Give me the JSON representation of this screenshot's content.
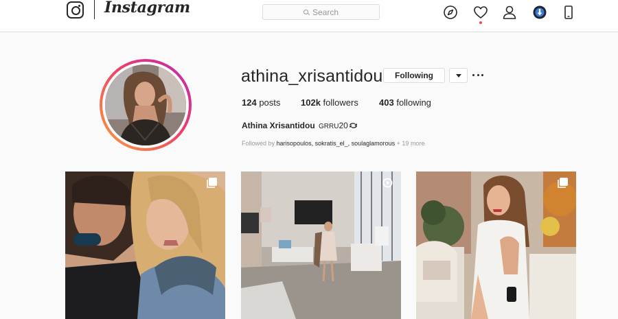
{
  "app": {
    "wordmark": "Instagram"
  },
  "nav": {
    "search_placeholder": "Search",
    "icons": [
      "compass-icon",
      "heart-icon",
      "person-icon",
      "download-icon",
      "phone-icon"
    ]
  },
  "profile": {
    "username": "athina_xrisantidou",
    "following_button": "Following",
    "stats": {
      "posts_count": "124",
      "posts_label": "posts",
      "followers_count": "102k",
      "followers_label": "followers",
      "following_count": "403",
      "following_label": "following"
    },
    "full_name": "Athina Xrisantidou",
    "bio_tag": "GRRU",
    "bio_num": "20",
    "followed_by": {
      "prefix": "Followed by",
      "users": "harisopoulos, sokratis_el_, soulaglamorous",
      "more": "+ 19 more"
    }
  },
  "posts": [
    {
      "type": "carousel",
      "icon": "multiple-photos-icon"
    },
    {
      "type": "video",
      "icon": "video-icon"
    },
    {
      "type": "carousel",
      "icon": "multiple-photos-icon"
    }
  ]
}
